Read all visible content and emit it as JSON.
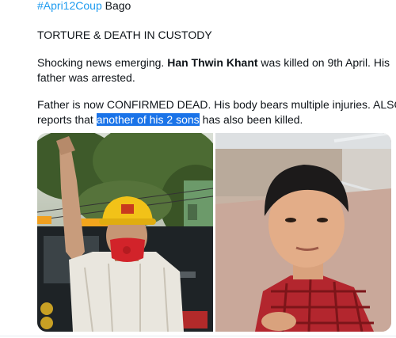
{
  "tweet": {
    "hashtag": "#Apri12Coup",
    "location": "Bago",
    "heading": "TORTURE & DEATH IN CUSTODY",
    "para1": {
      "pre": "Shocking news emerging. ",
      "name": "Han Thwin Khant",
      "post": " was killed on 9th April. His",
      "line2": "father was arrested."
    },
    "para2": {
      "line1": "Father is now CONFIRMED DEAD. His body bears multiple injuries. ALSO",
      "line2_pre": "reports that ",
      "line2_highlight": "another of his 2 sons",
      "line2_post": " has also been killed."
    }
  },
  "media": {
    "photos": [
      {
        "icon": "man-with-raised-hand-photo"
      },
      {
        "icon": "young-man-portrait-photo"
      }
    ]
  },
  "colors": {
    "hashtag": "#1d9bf0",
    "selection": "#1a73e8",
    "text": "#0f1419"
  }
}
